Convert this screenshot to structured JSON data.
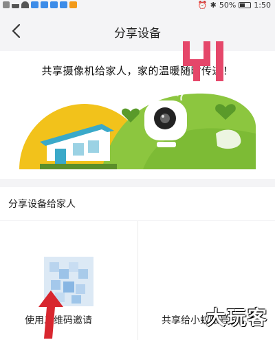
{
  "status_bar": {
    "left_icons": [
      "hd-icon",
      "signal-icon",
      "wifi-icon",
      "app-icon",
      "app-icon",
      "app-icon",
      "app-icon",
      "play-icon"
    ],
    "right_icons": [
      "alarm-icon",
      "bluetooth-icon"
    ],
    "battery_text": "50%",
    "battery_level": 0.5,
    "time": "1:50"
  },
  "nav": {
    "back_icon": "chevron-left-icon",
    "title": "分享设备"
  },
  "banner": {
    "text": "共享摄像机给家人，家的温暖随时传递！",
    "colors": {
      "sun": "#f2c21b",
      "hill": "#8cc63f",
      "house": "#3aa9c9"
    }
  },
  "section": {
    "title": "分享设备给家人"
  },
  "options": [
    {
      "label": "使用二维码邀请",
      "icon": "qr-code-icon"
    },
    {
      "label": "共享给小蚁账号",
      "icon": "yi-logo-icon",
      "logo_text": "YI",
      "logo_color": "#e5476a"
    }
  ],
  "overlay": {
    "watermark": "大玩客",
    "arrow_color": "#d8272f"
  }
}
